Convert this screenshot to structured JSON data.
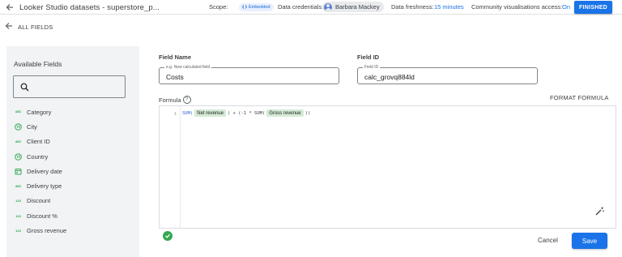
{
  "header": {
    "title": "Looker Studio datasets - superstore_p...",
    "scope_label": "Scope:",
    "scope_chip": "Embedded",
    "credentials_label": "Data credentials:",
    "credentials_user": "Barbara Mackey",
    "freshness_label": "Data freshness:",
    "freshness_value": "15 minutes",
    "community_label": "Community visualisations access:",
    "community_value": "On",
    "finished_label": "FINISHED"
  },
  "subheader": {
    "back_label": "ALL FIELDS"
  },
  "sidebar": {
    "title": "Available Fields",
    "fields": [
      {
        "label": "Category",
        "icon": "text-type-icon",
        "tag": "ABC"
      },
      {
        "label": "City",
        "icon": "globe-icon",
        "tag": ""
      },
      {
        "label": "Client ID",
        "icon": "text-type-icon",
        "tag": "ABC"
      },
      {
        "label": "Country",
        "icon": "globe-icon",
        "tag": ""
      },
      {
        "label": "Delivery date",
        "icon": "calendar-icon",
        "tag": ""
      },
      {
        "label": "Delivery type",
        "icon": "text-type-icon",
        "tag": "ABC"
      },
      {
        "label": "Discount",
        "icon": "number-type-icon",
        "tag": "123"
      },
      {
        "label": "Discount %",
        "icon": "number-type-icon",
        "tag": "123"
      },
      {
        "label": "Gross revenue",
        "icon": "number-type-icon",
        "tag": "123"
      }
    ]
  },
  "form": {
    "field_name_label": "Field Name",
    "field_name_legend": "e.g. New calculated field",
    "field_name_value": "Costs",
    "field_id_label": "Field ID",
    "field_id_legend": "Field ID",
    "field_id_value": "calc_grovq884ld",
    "formula_label": "Formula",
    "format_formula_label": "FORMAT FORMULA",
    "formula": {
      "line_number": "1",
      "fn1": "SUM(",
      "field1": "Net revenue",
      "mid": ") + (-1 * SUM(",
      "field2": "Gross revenue",
      "end": "))"
    },
    "cancel_label": "Cancel",
    "save_label": "Save"
  },
  "colors": {
    "accent": "#1a73e8",
    "field_chip": "#d4ead5",
    "valid": "#34a853",
    "panel_bg": "#f1f3f4"
  }
}
